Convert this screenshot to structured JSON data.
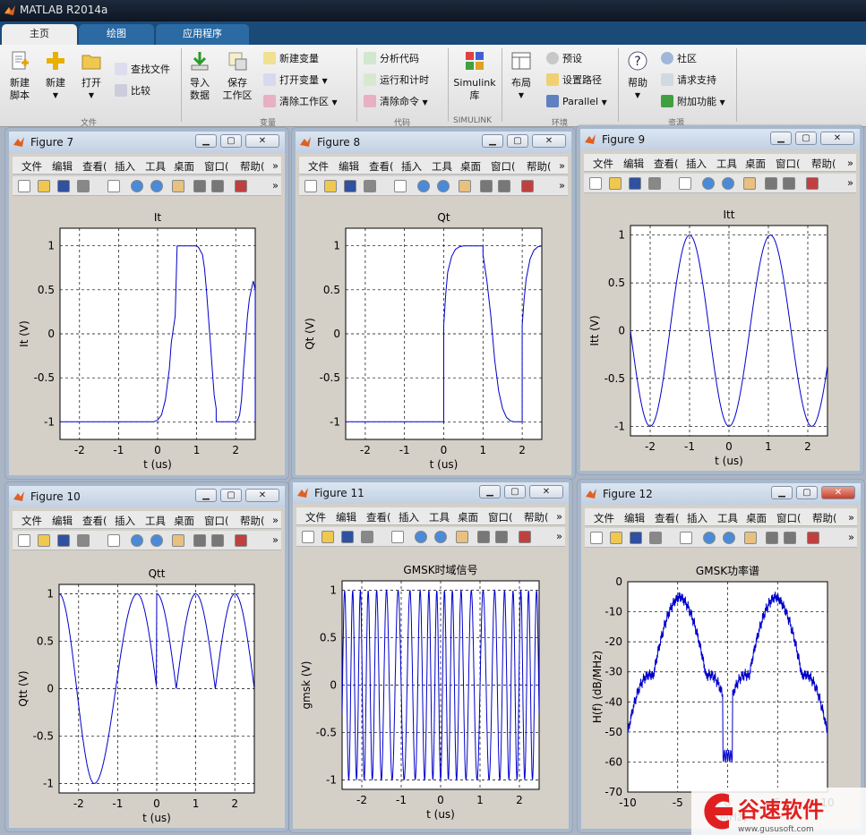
{
  "app": {
    "title": "MATLAB R2014a"
  },
  "tabs": [
    {
      "label": "主页",
      "active": true
    },
    {
      "label": "绘图",
      "active": false
    },
    {
      "label": "应用程序",
      "active": false
    }
  ],
  "ribbon": {
    "new_script": [
      "新建",
      "脚本"
    ],
    "new": "新建",
    "open": "打开",
    "find_files": "查找文件",
    "compare": "比较",
    "import_data": [
      "导入",
      "数据"
    ],
    "save_workspace": [
      "保存",
      "工作区"
    ],
    "new_variable": "新建变量",
    "open_variable": "打开变量",
    "clear_workspace": "清除工作区",
    "analyze_code": "分析代码",
    "run_and_time": "运行和计时",
    "clear_commands": "清除命令",
    "simulink_library": [
      "Simulink",
      "库"
    ],
    "layout": "布局",
    "preferences": "预设",
    "set_path": "设置路径",
    "parallel": "Parallel",
    "help": "帮助",
    "community": "社区",
    "request_support": "请求支持",
    "add_ons": "附加功能",
    "groups": {
      "file": "文件",
      "variable": "变量",
      "code": "代码",
      "simulink": "SIMULINK",
      "environment": "环境",
      "resources": "资源"
    }
  },
  "figure_menu": [
    "文件",
    "编辑",
    "查看(",
    "插入",
    "工具",
    "桌面",
    "窗口(",
    "帮助("
  ],
  "figures": [
    {
      "id": "fig7",
      "title": "Figure 7",
      "chart_data": {
        "type": "line",
        "title": "It",
        "xlabel": "t (us)",
        "ylabel": "It (V)",
        "xlim": [
          -2.5,
          2.5
        ],
        "ylim": [
          -1.2,
          1.2
        ],
        "xticks": [
          -2,
          -1,
          0,
          1,
          2
        ],
        "yticks": [
          -1,
          -0.5,
          0,
          0.5,
          1
        ],
        "grid": true,
        "color": "#0000cc",
        "series": [
          {
            "x": [
              -2.5,
              -0.1,
              0,
              0.1,
              0.2,
              0.3,
              0.35,
              0.45,
              0.5,
              1,
              1.05,
              1.15,
              1.2,
              1.25,
              1.3,
              1.35,
              1.4,
              1.45,
              1.5,
              1.5,
              1.7,
              1.9,
              2,
              2.05,
              2.1,
              2.15,
              2.2,
              2.25,
              2.3,
              2.35,
              2.4,
              2.45,
              2.5,
              2.5
            ],
            "y": [
              -1,
              -1,
              -0.98,
              -0.92,
              -0.75,
              -0.4,
              -0.1,
              0.2,
              1,
              1,
              0.98,
              0.9,
              0.75,
              0.5,
              0.2,
              -0.1,
              -0.4,
              -0.7,
              -0.85,
              -1,
              -1,
              -1,
              -1,
              -0.98,
              -0.92,
              -0.75,
              -0.4,
              -0.1,
              0.2,
              0.4,
              0.5,
              0.6,
              0.5,
              -1
            ]
          }
        ]
      }
    },
    {
      "id": "fig8",
      "title": "Figure 8",
      "chart_data": {
        "type": "line",
        "title": "Qt",
        "xlabel": "t (us)",
        "ylabel": "Qt (V)",
        "xlim": [
          -2.5,
          2.5
        ],
        "ylim": [
          -1.2,
          1.2
        ],
        "xticks": [
          -2,
          -1,
          0,
          1,
          2
        ],
        "yticks": [
          -1,
          -0.5,
          0,
          0.5,
          1
        ],
        "grid": true,
        "color": "#0000cc",
        "series": [
          {
            "x": [
              -2.5,
              0,
              0,
              0.05,
              0.1,
              0.2,
              0.3,
              0.4,
              0.5,
              0.6,
              0.7,
              0.8,
              1,
              1,
              1.1,
              1.2,
              1.3,
              1.4,
              1.5,
              1.6,
              1.7,
              1.8,
              2,
              2,
              2.05,
              2.1,
              2.2,
              2.3,
              2.4,
              2.5
            ],
            "y": [
              -1,
              -1,
              0.1,
              0.45,
              0.7,
              0.88,
              0.96,
              0.99,
              1,
              1,
              1,
              1,
              1,
              0.9,
              0.6,
              0.2,
              -0.3,
              -0.65,
              -0.85,
              -0.95,
              -0.99,
              -1,
              -1,
              0.1,
              0.4,
              0.62,
              0.85,
              0.95,
              0.99,
              1
            ]
          }
        ]
      }
    },
    {
      "id": "fig9",
      "title": "Figure 9",
      "chart_data": {
        "type": "line",
        "title": "Itt",
        "xlabel": "t (us)",
        "ylabel": "Itt (V)",
        "xlim": [
          -2.5,
          2.5
        ],
        "ylim": [
          -1.1,
          1.1
        ],
        "xticks": [
          -2,
          -1,
          0,
          1,
          2
        ],
        "yticks": [
          -1,
          -0.5,
          0,
          0.5,
          1
        ],
        "grid": true,
        "color": "#0000cc",
        "series": [
          {
            "formula": "itt"
          }
        ]
      }
    },
    {
      "id": "fig10",
      "title": "Figure 10",
      "chart_data": {
        "type": "line",
        "title": "Qtt",
        "xlabel": "t (us)",
        "ylabel": "Qtt (V)",
        "xlim": [
          -2.5,
          2.5
        ],
        "ylim": [
          -1.1,
          1.1
        ],
        "xticks": [
          -2,
          -1,
          0,
          1,
          2
        ],
        "yticks": [
          -1,
          -0.5,
          0,
          0.5,
          1
        ],
        "grid": true,
        "color": "#0000cc",
        "series": [
          {
            "formula": "qtt"
          }
        ]
      }
    },
    {
      "id": "fig11",
      "title": "Figure 11",
      "chart_data": {
        "type": "line",
        "title": "GMSK时域信号",
        "xlabel": "t (us)",
        "ylabel": "gmsk (V)",
        "xlim": [
          -2.5,
          2.5
        ],
        "ylim": [
          -1.1,
          1.1
        ],
        "xticks": [
          -2,
          -1,
          0,
          1,
          2
        ],
        "yticks": [
          -1,
          -0.5,
          0,
          0.5,
          1
        ],
        "grid": true,
        "color": "#0000cc",
        "series": [
          {
            "formula": "gmsk",
            "cycles": 21
          }
        ]
      }
    },
    {
      "id": "fig12",
      "title": "Figure 12",
      "chart_data": {
        "type": "line",
        "title": "GMSK功率谱",
        "xlabel": "f (MHz)",
        "ylabel": "H(f) (dB/MHz)",
        "xlim": [
          -10,
          10
        ],
        "ylim": [
          -70,
          0
        ],
        "xticks": [
          -10,
          -5,
          0,
          5,
          10
        ],
        "yticks": [
          0,
          -10,
          -20,
          -30,
          -40,
          -50,
          -60,
          -70
        ],
        "grid": true,
        "color": "#0000cc",
        "series": [
          {
            "formula": "psd"
          }
        ]
      }
    }
  ],
  "watermark": {
    "brand": "谷速软件",
    "url": "www.gususoft.com"
  }
}
